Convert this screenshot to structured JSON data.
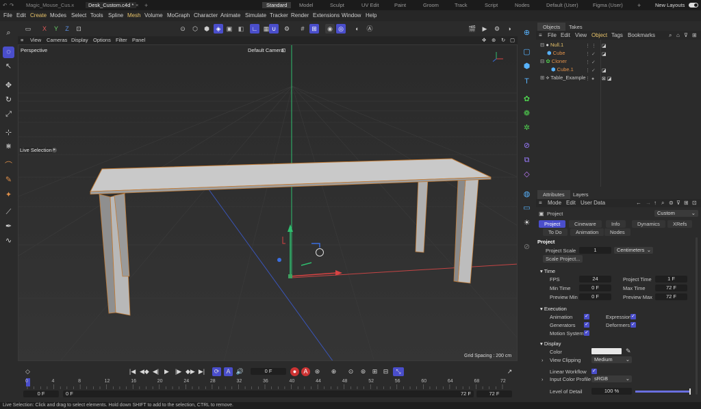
{
  "file_tabs": [
    "Magic_Mouse_Cus...",
    "Desk_Custom.c4d *"
  ],
  "plus": "+",
  "layouts": [
    "Standard",
    "Model",
    "Sculpt",
    "UV Edit",
    "Paint",
    "Groom",
    "Track",
    "Script",
    "Nodes",
    "Default (User)",
    "Figma (User)"
  ],
  "layouts_plus": "+",
  "new_layouts": "New Layouts",
  "menu": [
    "File",
    "Edit",
    "Create",
    "Modes",
    "Select",
    "Tools",
    "Spline",
    "Mesh",
    "Volume",
    "MoGraph",
    "Character",
    "Animate",
    "Simulate",
    "Tracker",
    "Render",
    "Extensions",
    "Window",
    "Help"
  ],
  "toolbar": {
    "x": "X",
    "y": "Y",
    "z": "Z"
  },
  "viewport_menu": [
    "View",
    "Cameras",
    "Display",
    "Options",
    "Filter",
    "Panel"
  ],
  "viewport": {
    "label": "Perspective",
    "camera": "Default Camera",
    "live_selection": "Live Selection",
    "grid_spacing": "Grid Spacing : 200 cm"
  },
  "timeline": {
    "frame_field": "0 F",
    "ruler": [
      "0",
      "4",
      "8",
      "12",
      "16",
      "20",
      "24",
      "28",
      "32",
      "36",
      "40",
      "44",
      "48",
      "52",
      "56",
      "60",
      "64",
      "68",
      "72"
    ],
    "start_field": "0 F",
    "range_start": "0 F",
    "range_end": "72 F",
    "end_field": "72 F"
  },
  "status": "Live Selection: Click and drag to select elements. Hold down SHIFT to add to the selection, CTRL to remove.",
  "objects_panel": {
    "tabs": [
      "Objects",
      "Takes"
    ],
    "menu": [
      "File",
      "Edit",
      "View",
      "Object",
      "Tags",
      "Bookmarks"
    ],
    "items": [
      {
        "name": "Null.1",
        "color": "#e9c46a"
      },
      {
        "name": "Cube",
        "color": "#e0904a"
      },
      {
        "name": "Cloner",
        "color": "#e0904a"
      },
      {
        "name": "Cube.1",
        "color": "#e0904a"
      },
      {
        "name": "Table_Example",
        "color": "#c8c8c8"
      }
    ]
  },
  "attributes_panel": {
    "tabs": [
      "Attributes",
      "Layers"
    ],
    "menu": [
      "Mode",
      "Edit",
      "User Data"
    ],
    "context": "Project",
    "preset": "Custom",
    "subtabs": [
      "Project",
      "Cineware",
      "Info",
      "Dynamics",
      "XRefs",
      "To Do",
      "Animation",
      "Nodes"
    ],
    "heading": "Project",
    "project_scale_label": "Project Scale",
    "project_scale": "1",
    "unit": "Centimeters",
    "scale_button": "Scale Project...",
    "time_section": "Time",
    "fps_label": "FPS",
    "fps": "24",
    "project_time_label": "Project Time",
    "project_time": "1 F",
    "min_time_label": "Min Time",
    "min_time": "0 F",
    "max_time_label": "Max Time",
    "max_time": "72 F",
    "preview_min_label": "Preview Min",
    "preview_min": "0 F",
    "preview_max_label": "Preview Max",
    "preview_max": "72 F",
    "execution_section": "Execution",
    "animation": "Animation",
    "expression": "Expression",
    "generators": "Generators",
    "deformers": "Deformers",
    "motion_system": "Motion System",
    "display_section": "Display",
    "color_label": "Color",
    "view_clipping_label": "View Clipping",
    "view_clipping": "Medium",
    "linear_workflow": "Linear Workflow",
    "input_color_profile_label": "Input Color Profile",
    "input_color_profile": "sRGB",
    "level_of_detail_label": "Level of Detail",
    "level_of_detail": "100 %",
    "level_of_detail_fraction": 1.0
  },
  "accent": "#4a4ecb"
}
